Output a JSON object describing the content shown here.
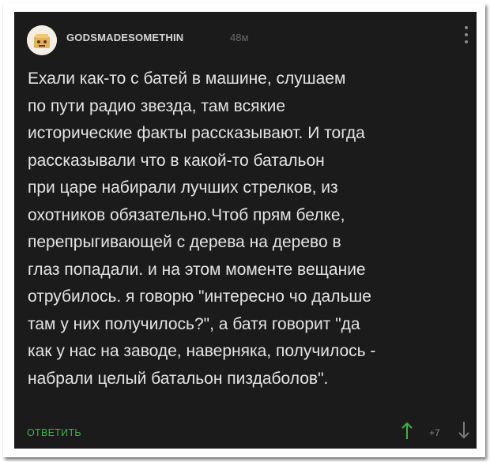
{
  "comment": {
    "username": "GODSMADESOMETHIN",
    "time": "48м",
    "lines": [
      "Ехали как-то с батей в машине, слушаем",
      "по пути радио звезда, там всякие",
      "исторические факты рассказывают. И тогда",
      "рассказывали что в какой-то батальон",
      "при царе набирали лучших стрелков, из",
      "охотников обязательно.Чтоб прям белке,",
      "перепрыгивающей с дерева на дерево в",
      "глаз попадали. и на этом моменте вещание",
      "отрубилось. я говорю \"интересно чо дальше",
      "там у них получилось?\", а батя говорит \"да",
      "как у нас на заводе, наверняка, получилось -",
      "набрали целый батальон пиздаболов\"."
    ],
    "reply_label": "ОТВЕТИТЬ",
    "score": "+7"
  },
  "colors": {
    "background": "#1b1b1b",
    "text": "#e4e4e4",
    "username": "#d7d7d7",
    "muted": "#6d6d6d",
    "accent": "#3fb249"
  },
  "icons": {
    "avatar": "avatar-image",
    "menu": "more-vertical-icon",
    "upvote": "arrow-up-icon",
    "downvote": "arrow-down-icon"
  }
}
